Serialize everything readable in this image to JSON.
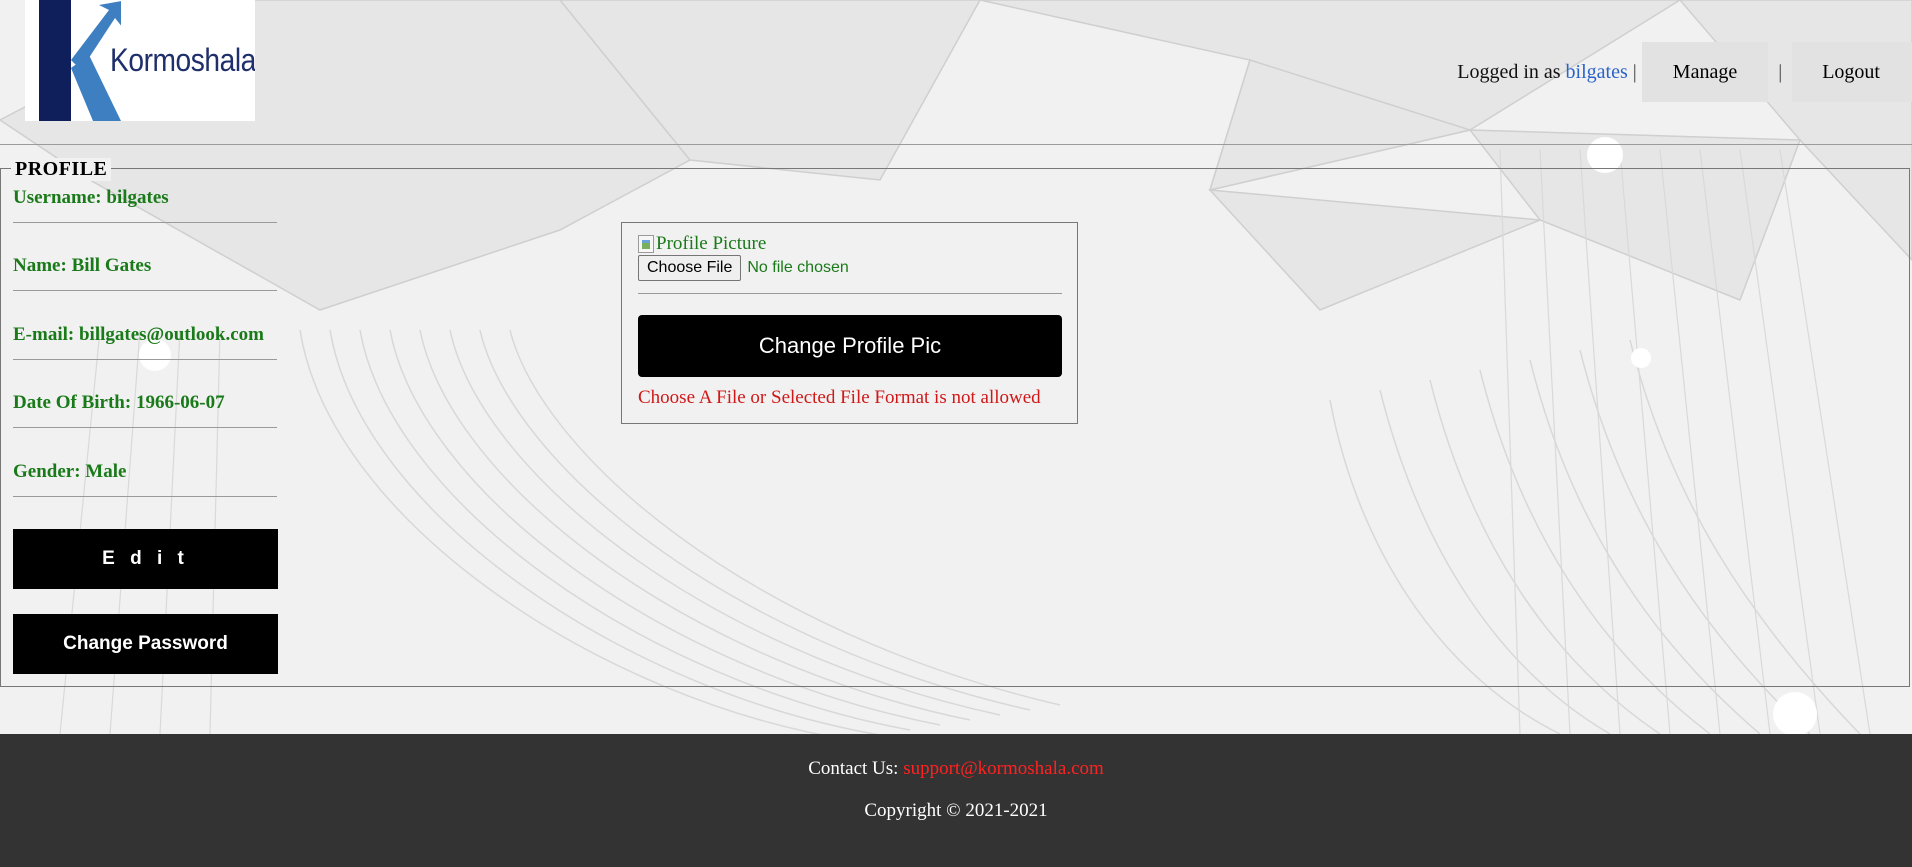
{
  "header": {
    "logo_text": "Kormoshala",
    "logged_in_prefix": "Logged in as",
    "username": "bilgates",
    "separator": "|",
    "manage_label": "Manage",
    "logout_label": "Logout"
  },
  "profile": {
    "legend": "PROFILE",
    "fields": [
      {
        "label": "Username:",
        "value": "bilgates"
      },
      {
        "label": "Name:",
        "value": "Bill Gates"
      },
      {
        "label": "E-mail:",
        "value": "billgates@outlook.com"
      },
      {
        "label": "Date Of Birth:",
        "value": "1966-06-07"
      },
      {
        "label": "Gender:",
        "value": "Male"
      }
    ],
    "edit_label": "E d i t",
    "change_password_label": "Change Password"
  },
  "picture": {
    "alt_text": "Profile Picture",
    "choose_file_label": "Choose File",
    "file_status": "No file chosen",
    "change_pic_label": "Change Profile Pic",
    "error_message": "Choose A File or Selected File Format is not allowed"
  },
  "footer": {
    "contact_label": "Contact Us:",
    "email": "support@kormoshala.com",
    "copyright": "Copyright © 2021-2021"
  },
  "colors": {
    "logo_dark": "#0f1f5c",
    "logo_light": "#3d7fc1",
    "field_green": "#1a7a1a",
    "error_red": "#d01818",
    "link_blue": "#2a63c8",
    "footer_bg": "#333333"
  }
}
